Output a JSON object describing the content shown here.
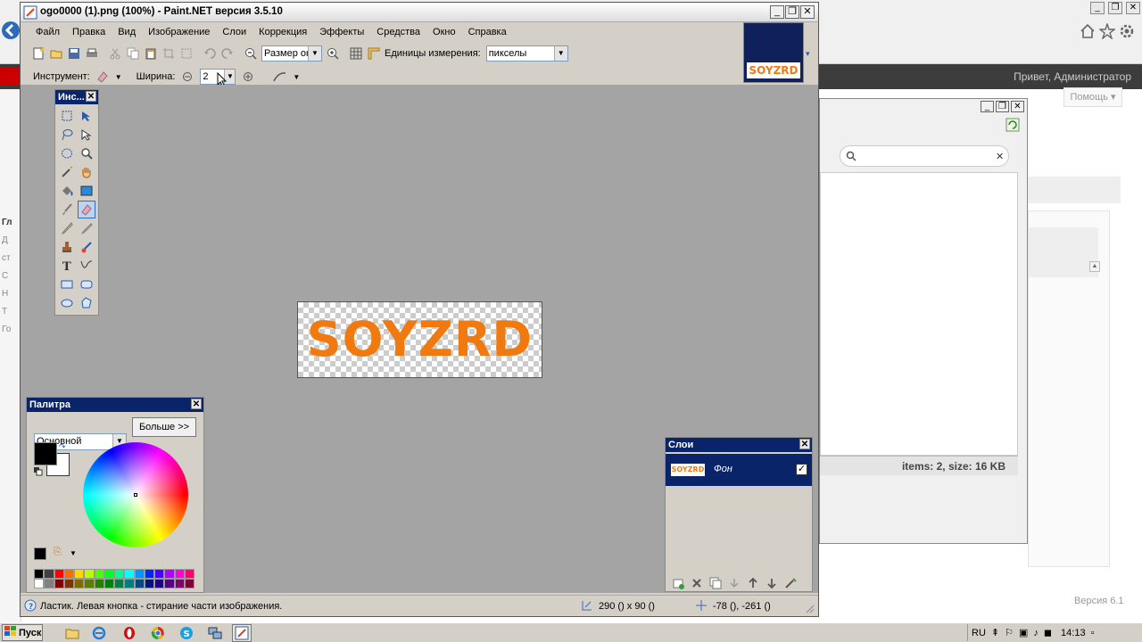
{
  "window": {
    "title": "ogo0000 (1).png (100%) - Paint.NET версия 3.5.10"
  },
  "menu": [
    "Файл",
    "Правка",
    "Вид",
    "Изображение",
    "Слои",
    "Коррекция",
    "Эффекты",
    "Средства",
    "Окно",
    "Справка"
  ],
  "toolbar": {
    "zoom_value": "Размер окн",
    "units_label": "Единицы измерения:",
    "units_value": "пикселы",
    "tool_label": "Инструмент:",
    "width_label": "Ширина:",
    "width_value": "2"
  },
  "tools_panel": {
    "title": "Инс..."
  },
  "canvas": {
    "logo_text": "SOYZRD",
    "thumb_text": "SOYZRD"
  },
  "palette": {
    "title": "Палитра",
    "mode_value": "Основной",
    "more_button": "Больше >>",
    "swatches": [
      "#000000",
      "#404040",
      "#ff0000",
      "#ff6a00",
      "#ffd800",
      "#b6ff00",
      "#4cff00",
      "#00ff21",
      "#00ff90",
      "#00ffff",
      "#0094ff",
      "#0026ff",
      "#4800ff",
      "#b200ff",
      "#ff00dc",
      "#ff006e",
      "#ffffff",
      "#808080",
      "#7f0000",
      "#7f3300",
      "#7f6a00",
      "#5b7f00",
      "#267f00",
      "#007f0e",
      "#007f46",
      "#007f7f",
      "#004a7f",
      "#00137f",
      "#21007f",
      "#57007f",
      "#7f006e",
      "#7f0037"
    ]
  },
  "layers": {
    "title": "Слои",
    "items": [
      {
        "name": "Фон",
        "thumb": "SOYZRD",
        "visible": true
      }
    ]
  },
  "status": {
    "hint": "Ластик. Левая кнопка - стирание части изображения.",
    "image_size": "290 () x 90 ()",
    "cursor_pos": "-78 (), -261 ()"
  },
  "background": {
    "greeting": "Привет, Администратор",
    "help": "Помощь",
    "version": "Версия 6.1",
    "explorer_status": "items: 2, size: 16 KB",
    "left_letters": [
      "Гл",
      "Д",
      "ст",
      "С",
      "Н",
      "Т",
      "Го"
    ]
  },
  "taskbar": {
    "start": "Пуск",
    "lang": "RU",
    "clock": "14:13"
  }
}
